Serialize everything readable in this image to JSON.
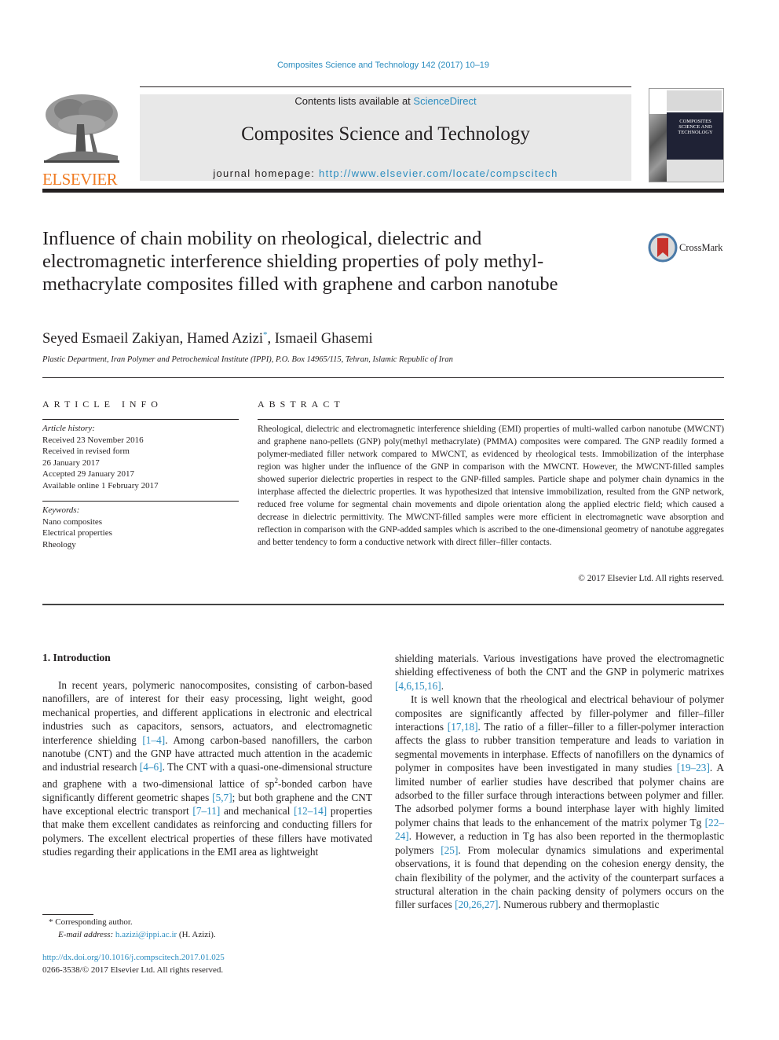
{
  "header": {
    "citation": "Composites Science and Technology 142 (2017) 10–19",
    "contents_prefix": "Contents lists available at ",
    "contents_link": "ScienceDirect",
    "journal_title": "Composites Science and Technology",
    "homepage_prefix": "journal homepage: ",
    "homepage_link": "http://www.elsevier.com/locate/compscitech",
    "publisher_logo": "ELSEVIER",
    "cover_title_lines": [
      "COMPOSITES",
      "SCIENCE AND",
      "TECHNOLOGY"
    ]
  },
  "article": {
    "title": "Influence of chain mobility on rheological, dielectric and electromagnetic interference shielding properties of poly methyl-methacrylate composites filled with graphene and carbon nanotube",
    "crossmark_label": "CrossMark",
    "authors": [
      {
        "name": "Seyed Esmaeil Zakiyan",
        "mark": ""
      },
      {
        "name": "Hamed Azizi",
        "mark": "*"
      },
      {
        "name": "Ismaeil Ghasemi",
        "mark": ""
      }
    ],
    "affiliation": "Plastic Department, Iran Polymer and Petrochemical Institute (IPPI), P.O. Box 14965/115, Tehran, Islamic Republic of Iran"
  },
  "article_info": {
    "heading": "ARTICLE INFO",
    "history_label": "Article history:",
    "history": [
      "Received 23 November 2016",
      "Received in revised form",
      "26 January 2017",
      "Accepted 29 January 2017",
      "Available online 1 February 2017"
    ],
    "keywords_label": "Keywords:",
    "keywords": [
      "Nano composites",
      "Electrical properties",
      "Rheology"
    ]
  },
  "abstract": {
    "heading": "ABSTRACT",
    "text": "Rheological, dielectric and electromagnetic interference shielding (EMI) properties of multi-walled carbon nanotube (MWCNT) and graphene nano-pellets (GNP) poly(methyl methacrylate) (PMMA) composites were compared. The GNP readily formed a polymer-mediated filler network compared to MWCNT, as evidenced by rheological tests. Immobilization of the interphase region was higher under the influence of the GNP in comparison with the MWCNT. However, the MWCNT-filled samples showed superior dielectric properties in respect to the GNP-filled samples. Particle shape and polymer chain dynamics in the interphase affected the dielectric properties. It was hypothesized that intensive immobilization, resulted from the GNP network, reduced free volume for segmental chain movements and dipole orientation along the applied electric field; which caused a decrease in dielectric permittivity. The MWCNT-filled samples were more efficient in electromagnetic wave absorption and reflection in comparison with the GNP-added samples which is ascribed to the one-dimensional geometry of nanotube aggregates and better tendency to form a conductive network with direct filler–filler contacts.",
    "copyright": "© 2017 Elsevier Ltd. All rights reserved."
  },
  "body": {
    "section_heading": "1.  Introduction",
    "left_paragraph": [
      {
        "t": "In recent years, polymeric nanocomposites, consisting of carbon-based nanofillers, are of interest for their easy processing, light weight, good mechanical properties, and different applications in electronic and electrical industries such as capacitors, sensors, actuators, and electromagnetic interference shielding "
      },
      {
        "ref": "[1–4]"
      },
      {
        "t": ". Among carbon-based nanofillers, the carbon nanotube (CNT) and the GNP have attracted much attention in the academic and industrial research "
      },
      {
        "ref": "[4–6]"
      },
      {
        "t": ". The CNT with a quasi-one-dimensional structure and graphene with a two-dimensional lattice of sp"
      },
      {
        "sup": "2"
      },
      {
        "t": "-bonded carbon have significantly different geometric shapes "
      },
      {
        "ref": "[5,7]"
      },
      {
        "t": "; but both graphene and the CNT have exceptional electric transport "
      },
      {
        "ref": "[7–11]"
      },
      {
        "t": " and mechanical "
      },
      {
        "ref": "[12–14]"
      },
      {
        "t": " properties that make them excellent candidates as reinforcing and conducting fillers for polymers. The excellent electrical properties of these fillers have motivated studies regarding their applications in the EMI area as lightweight"
      }
    ],
    "right_paragraph_1": [
      {
        "t": "shielding materials. Various investigations have proved the electromagnetic shielding effectiveness of both the CNT and the GNP in polymeric matrixes "
      },
      {
        "ref": "[4,6,15,16]"
      },
      {
        "t": "."
      }
    ],
    "right_paragraph_2": [
      {
        "t": "It is well known that the rheological and electrical behaviour of polymer composites are significantly affected by filler-polymer and filler–filler interactions "
      },
      {
        "ref": "[17,18]"
      },
      {
        "t": ". The ratio of a filler–filler to a filler-polymer interaction affects the glass to rubber transition temperature and leads to variation in segmental movements in interphase. Effects of nanofillers on the dynamics of polymer in composites have been investigated in many studies "
      },
      {
        "ref": "[19–23]"
      },
      {
        "t": ". A limited number of earlier studies have described that polymer chains are adsorbed to the filler surface through interactions between polymer and filler. The adsorbed polymer forms a bound interphase layer with highly limited polymer chains that leads to the enhancement of the matrix polymer Tg "
      },
      {
        "ref": "[22–24]"
      },
      {
        "t": ". However, a reduction in Tg has also been reported in the thermoplastic polymers "
      },
      {
        "ref": "[25]"
      },
      {
        "t": ". From molecular dynamics simulations and experimental observations, it is found that depending on the cohesion energy density, the chain flexibility of the polymer, and the activity of the counterpart surfaces a structural alteration in the chain packing density of polymers occurs on the filler surfaces "
      },
      {
        "ref": "[20,26,27]"
      },
      {
        "t": ". Numerous rubbery and thermoplastic"
      }
    ]
  },
  "footnote": {
    "marker": "*",
    "corresponding": "Corresponding author.",
    "email_label": "E-mail address:",
    "email": "h.azizi@ippi.ac.ir",
    "email_suffix": " (H. Azizi)."
  },
  "doi": {
    "link": "http://dx.doi.org/10.1016/j.compscitech.2017.01.025",
    "issn_line": "0266-3538/© 2017 Elsevier Ltd. All rights reserved."
  },
  "colors": {
    "link": "#2a8cbf",
    "elsevier_orange": "#f07b22",
    "masthead_bg": "#e8e8e8",
    "crossmark_red": "#c8322c"
  }
}
